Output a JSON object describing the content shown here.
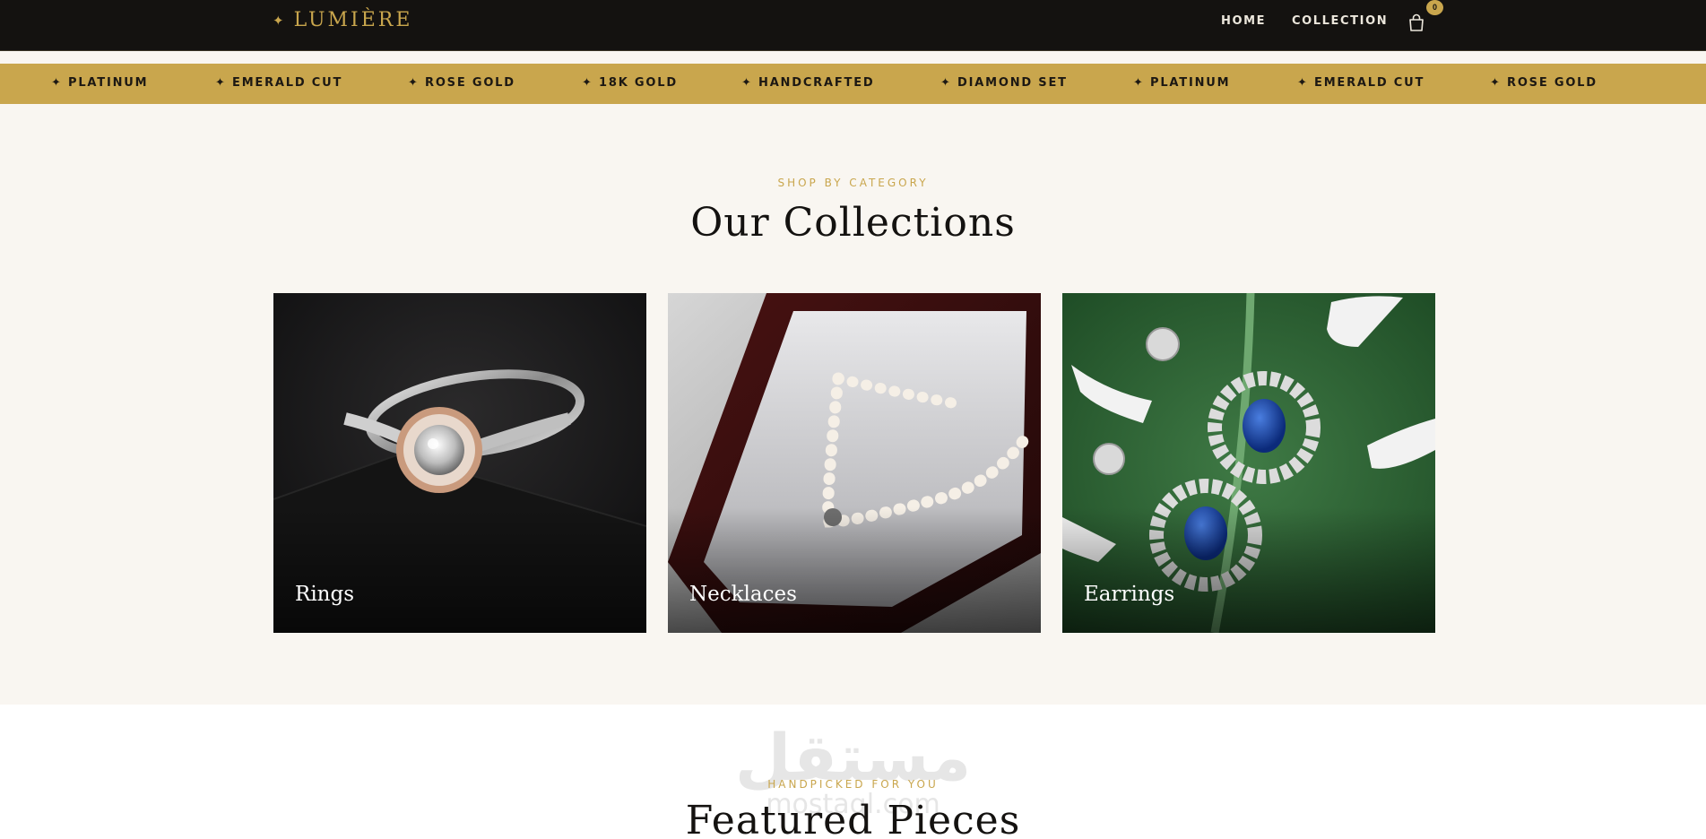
{
  "header": {
    "logo_symbol": "✦",
    "logo_text": "LUMIÈRE",
    "nav": [
      {
        "label": "HOME"
      },
      {
        "label": "COLLECTION"
      }
    ],
    "cart_count": "0"
  },
  "ticker": {
    "items": [
      "✦ PLATINUM",
      "✦ EMERALD CUT",
      "✦ ROSE GOLD",
      "✦ 18K GOLD",
      "✦ HANDCRAFTED",
      "✦ DIAMOND SET",
      "✦ PLATINUM",
      "✦ EMERALD CUT",
      "✦ ROSE GOLD"
    ]
  },
  "collections": {
    "eyebrow": "SHOP BY CATEGORY",
    "title": "Our Collections",
    "cards": [
      {
        "label": "Rings"
      },
      {
        "label": "Necklaces"
      },
      {
        "label": "Earrings"
      }
    ]
  },
  "featured": {
    "eyebrow": "HANDPICKED FOR YOU",
    "title": "Featured Pieces"
  },
  "watermark": {
    "arabic": "مستقل",
    "latin": "mostaql.com"
  },
  "colors": {
    "accent": "#c9a64d",
    "header_bg": "#141210",
    "section_bg": "#f9f6f1"
  }
}
